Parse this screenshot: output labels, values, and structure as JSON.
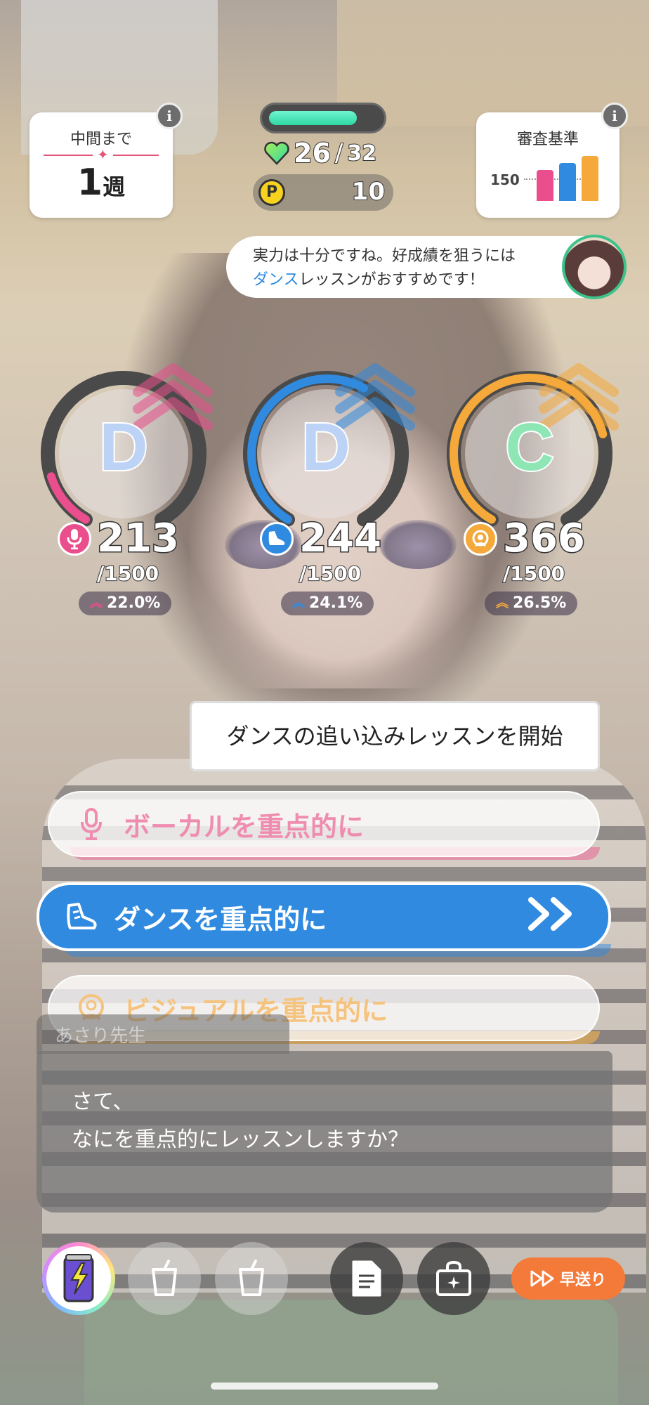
{
  "week": {
    "label": "中間まで",
    "value": "1",
    "unit": "週"
  },
  "criteria": {
    "title": "審査基準",
    "threshold": "150",
    "colors": [
      "#ea4e8c",
      "#2f8ae0",
      "#f5a93a"
    ]
  },
  "stamina": {
    "fill_fraction": 0.8125,
    "current": "26",
    "slash": "/",
    "max": "32"
  },
  "pp": {
    "icon_letter": "P",
    "value": "10"
  },
  "advice": {
    "line1": "実力は十分ですね。好成績を狙うには",
    "highlight": "ダンス",
    "line2_rest": "レッスンがおすすめです！"
  },
  "stats": [
    {
      "name": "vocal",
      "rank": "D",
      "value": "213",
      "max": "/1500",
      "pct": "22.0%",
      "gauge_fraction": 0.142,
      "color": "#ea4e8c",
      "icon": "microphone-icon"
    },
    {
      "name": "dance",
      "rank": "D",
      "value": "244",
      "max": "/1500",
      "pct": "24.1%",
      "gauge_fraction": 0.6,
      "color": "#2f8ae0",
      "icon": "shoe-icon"
    },
    {
      "name": "visual",
      "rank": "C",
      "value": "366",
      "max": "/1500",
      "pct": "26.5%",
      "gauge_fraction": 0.75,
      "color": "#f5a93a",
      "icon": "sparkle-face-icon"
    }
  ],
  "prompt": "ダンスの追い込みレッスンを開始",
  "choices": [
    {
      "key": "vocal",
      "label": "ボーカルを重点的に",
      "selected": false
    },
    {
      "key": "dance",
      "label": "ダンスを重点的に",
      "selected": true
    },
    {
      "key": "visual",
      "label": "ビジュアルを重点的に",
      "selected": false
    }
  ],
  "dialogue": {
    "speaker": "あさり先生",
    "line1": "さて、",
    "line2": "なにを重点的にレッスンしますか？"
  },
  "bottom_bar": {
    "fast_forward": "早送り"
  }
}
